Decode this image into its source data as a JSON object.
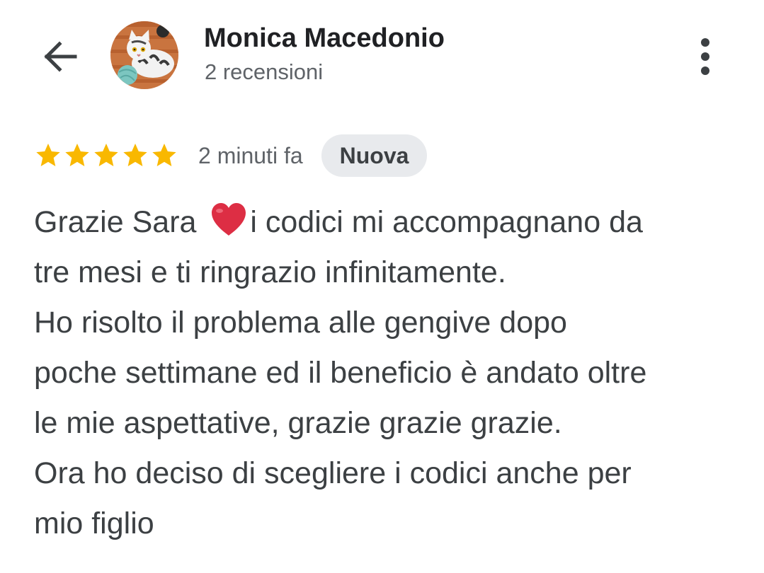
{
  "header": {
    "back_icon": "arrow-back-icon",
    "author_name": "Monica Macedonio",
    "review_count": "2 recensioni",
    "more_icon": "more-vert-icon"
  },
  "review": {
    "rating": 5,
    "rating_max": 5,
    "star_color": "#f9b800",
    "time": "2 minuti fa",
    "badge": "Nuova",
    "lines": [
      {
        "before": "Grazie Sara ",
        "after": "i codici mi accompagnano da",
        "icon": "red-heart-icon"
      },
      {
        "text": "tre mesi e ti ringrazio infinitamente."
      },
      {
        "text": "Ho risolto il problema alle gengive dopo"
      },
      {
        "text": "poche settimane ed il beneficio è andato oltre"
      },
      {
        "text": "le mie aspettative, grazie grazie grazie."
      },
      {
        "text": "Ora ho deciso di scegliere i codici anche per"
      },
      {
        "text": "mio figlio"
      }
    ]
  }
}
